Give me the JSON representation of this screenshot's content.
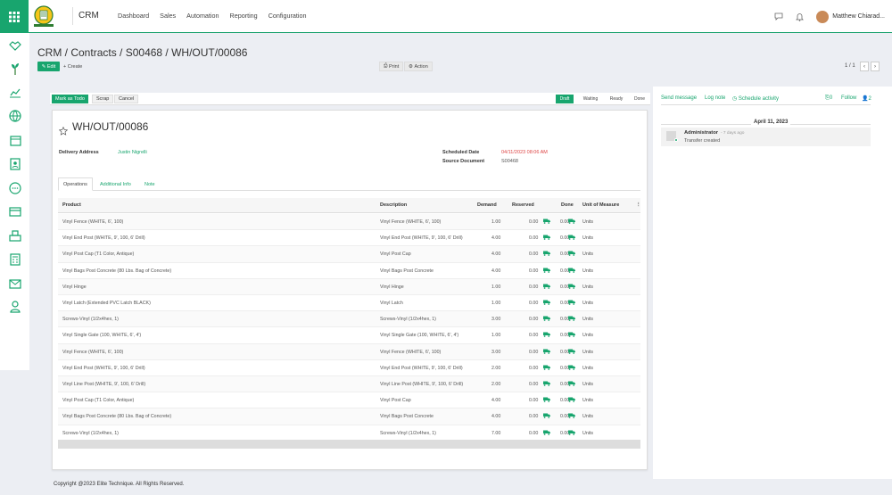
{
  "topbar": {
    "app_name": "CRM",
    "menu": [
      "Dashboard",
      "Sales",
      "Automation",
      "Reporting",
      "Configuration"
    ],
    "user_name": "Matthew Chiarad..."
  },
  "breadcrumb": {
    "parts": [
      "CRM",
      "Contracts",
      "S00468",
      "WH/OUT/00086"
    ],
    "separator": " / "
  },
  "controls": {
    "edit": "Edit",
    "create": "Create",
    "print": "Print",
    "action": "Action",
    "pager": "1 / 1"
  },
  "statusbar": {
    "mark_todo": "Mark as Todo",
    "scrap": "Scrap",
    "cancel": "Cancel",
    "stages": [
      "Draft",
      "Waiting",
      "Ready",
      "Done"
    ],
    "active_stage": "Draft"
  },
  "record": {
    "title": "WH/OUT/00086",
    "delivery_address_label": "Delivery Address",
    "delivery_address": "Justin Nigrelli",
    "scheduled_date_label": "Scheduled Date",
    "scheduled_date": "04/11/2023 08:06 AM",
    "source_document_label": "Source Document",
    "source_document": "S00468"
  },
  "tabs": [
    "Operations",
    "Additional Info",
    "Note"
  ],
  "table": {
    "headers": [
      "Product",
      "Description",
      "Demand",
      "Reserved",
      "Done",
      "Unit of Measure"
    ],
    "rows": [
      {
        "product": "Vinyl Fence (WHITE, 6', 100)",
        "description": "Vinyl Fence (WHITE, 6', 100)",
        "demand": "1.00",
        "reserved": "0.00",
        "done": "0.00",
        "uom": "Units"
      },
      {
        "product": "Vinyl End Post (WHITE, 9', 100, 6' Drill)",
        "description": "Vinyl End Post (WHITE, 9', 100, 6' Drill)",
        "demand": "4.00",
        "reserved": "0.00",
        "done": "0.00",
        "uom": "Units"
      },
      {
        "product": "Vinyl Post Cap (T1 Color, Antique)",
        "description": "Vinyl Post Cap",
        "demand": "4.00",
        "reserved": "0.00",
        "done": "0.00",
        "uom": "Units"
      },
      {
        "product": "Vinyl Bags Post Concrete (80 Lbs. Bag of Concrete)",
        "description": "Vinyl Bags Post Concrete",
        "demand": "4.00",
        "reserved": "0.00",
        "done": "0.00",
        "uom": "Units"
      },
      {
        "product": "Vinyl Hinge",
        "description": "Vinyl Hinge",
        "demand": "1.00",
        "reserved": "0.00",
        "done": "0.00",
        "uom": "Units"
      },
      {
        "product": "Vinyl Latch (Extended PVC Latch BLACK)",
        "description": "Vinyl Latch",
        "demand": "1.00",
        "reserved": "0.00",
        "done": "0.00",
        "uom": "Units"
      },
      {
        "product": "Screws-Vinyl (1/2x4hex, 1)",
        "description": "Screws-Vinyl (1/2x4hex, 1)",
        "demand": "3.00",
        "reserved": "0.00",
        "done": "0.00",
        "uom": "Units"
      },
      {
        "product": "Vinyl Single Gate (100, WHITE, 6', 4')",
        "description": "Vinyl Single Gate (100, WHITE, 6', 4')",
        "demand": "1.00",
        "reserved": "0.00",
        "done": "0.00",
        "uom": "Units"
      },
      {
        "product": "Vinyl Fence (WHITE, 6', 100)",
        "description": "Vinyl Fence (WHITE, 6', 100)",
        "demand": "3.00",
        "reserved": "0.00",
        "done": "0.00",
        "uom": "Units"
      },
      {
        "product": "Vinyl End Post (WHITE, 9', 100, 6' Drill)",
        "description": "Vinyl End Post (WHITE, 9', 100, 6' Drill)",
        "demand": "2.00",
        "reserved": "0.00",
        "done": "0.00",
        "uom": "Units"
      },
      {
        "product": "Vinyl Line Post (WHITE, 9', 100, 6' Drill)",
        "description": "Vinyl Line Post (WHITE, 9', 100, 6' Drill)",
        "demand": "2.00",
        "reserved": "0.00",
        "done": "0.00",
        "uom": "Units"
      },
      {
        "product": "Vinyl Post Cap (T1 Color, Antique)",
        "description": "Vinyl Post Cap",
        "demand": "4.00",
        "reserved": "0.00",
        "done": "0.00",
        "uom": "Units"
      },
      {
        "product": "Vinyl Bags Post Concrete (80 Lbs. Bag of Concrete)",
        "description": "Vinyl Bags Post Concrete",
        "demand": "4.00",
        "reserved": "0.00",
        "done": "0.00",
        "uom": "Units"
      },
      {
        "product": "Screws-Vinyl (1/2x4hex, 1)",
        "description": "Screws-Vinyl (1/2x4hex, 1)",
        "demand": "7.00",
        "reserved": "0.00",
        "done": "0.00",
        "uom": "Units"
      }
    ]
  },
  "chatter": {
    "send_message": "Send message",
    "log_note": "Log note",
    "schedule_activity": "Schedule activity",
    "attachments": "0",
    "follow": "Follow",
    "followers": "2",
    "date": "April 11, 2023",
    "author": "Administrator",
    "time": "- 7 days ago",
    "message": "Transfer created"
  },
  "footer": "Copyright @2023 Elite Technique. All Rights Reserved.",
  "colors": {
    "accent": "#18a56e",
    "danger": "#d44444"
  },
  "icons": [
    "apps-grid-icon",
    "logo",
    "chat-icon",
    "bell-icon",
    "handshake-icon",
    "plant-icon",
    "chart-icon",
    "globe-icon",
    "calendar-icon",
    "contact-card-icon",
    "chat-bubble-icon",
    "credit-card-icon",
    "warehouse-icon",
    "calculator-icon",
    "mail-icon",
    "user-icon",
    "star-icon",
    "truck-icon",
    "paperclip-icon",
    "followers-icon",
    "print-icon",
    "gear-icon"
  ]
}
